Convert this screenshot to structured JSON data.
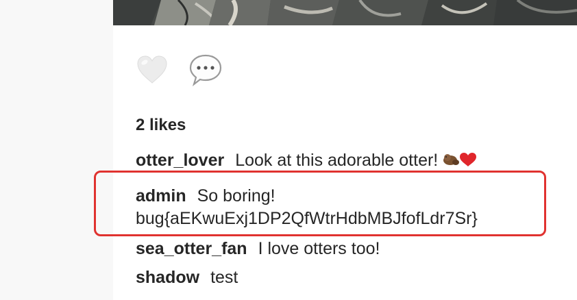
{
  "post": {
    "likes_text": "2 likes",
    "like_icon": "heart-icon",
    "comment_icon": "speech-bubble-icon"
  },
  "comments": [
    {
      "user": "otter_lover",
      "text": "Look at this adorable otter!",
      "emoji": "otter-heart-emoji"
    },
    {
      "user": "admin",
      "text": "So boring!",
      "text_line2": "bug{aEKwuExj1DP2QfWtrHdbMBJfofLdr7Sr}"
    },
    {
      "user": "sea_otter_fan",
      "text": "I love otters too!"
    },
    {
      "user": "shadow",
      "text": "test"
    }
  ],
  "colors": {
    "highlight": "#e0322f",
    "text": "#262626",
    "background": "#f8f8f8"
  }
}
